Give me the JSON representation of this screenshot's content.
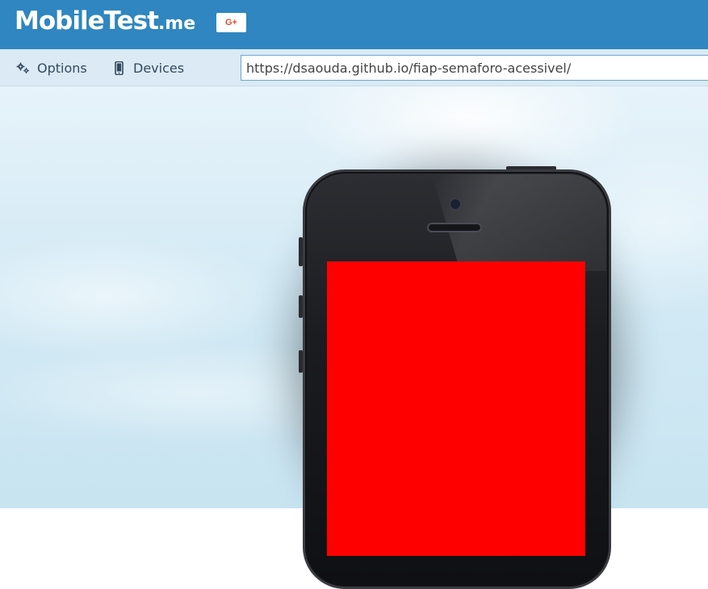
{
  "header": {
    "logo_brand": "MobileTest",
    "logo_tld": ".me",
    "gplus_label": "G+"
  },
  "toolbar": {
    "options_label": "Options",
    "devices_label": "Devices",
    "url_value": "https://dsaouda.github.io/fiap-semaforo-acessivel/"
  },
  "device": {
    "screen_color": "#ff0000"
  },
  "colors": {
    "header_bg": "#2f86c0",
    "toolbar_bg": "#dbeaf4",
    "url_border": "#6aa6d6"
  },
  "icons": {
    "options": "gears-icon",
    "devices": "mobile-phone-icon",
    "share": "google-plus-icon"
  }
}
